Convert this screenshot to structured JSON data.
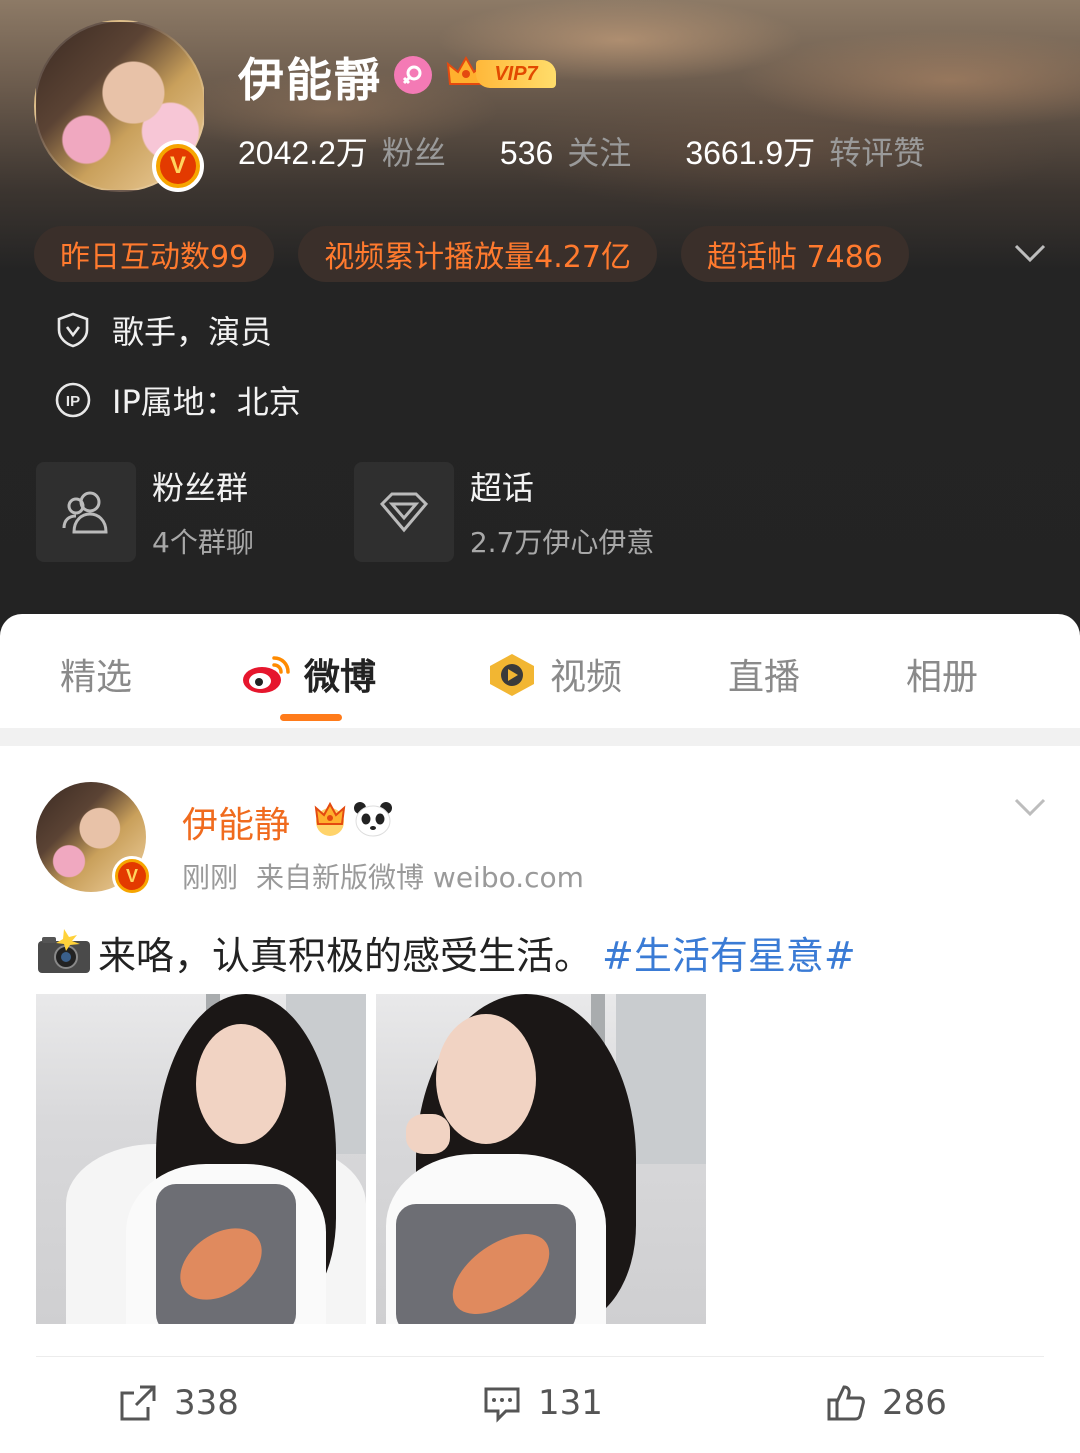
{
  "profile": {
    "name": "伊能靜",
    "vip_label": "VIP7",
    "verified_badge": "V",
    "stats": [
      {
        "value": "2042.2万",
        "label": "粉丝"
      },
      {
        "value": "536",
        "label": "关注"
      },
      {
        "value": "3661.9万",
        "label": "转评赞"
      }
    ],
    "chips": [
      {
        "label": "昨日互动数99"
      },
      {
        "label": "视频累计播放量4.27亿"
      },
      {
        "label": "超话帖 7486"
      }
    ],
    "info": [
      {
        "icon": "shield-v-icon",
        "text": "歌手，演员"
      },
      {
        "icon": "ip-icon",
        "text": "IP属地：北京"
      }
    ],
    "cards": [
      {
        "icon": "people-icon",
        "title": "粉丝群",
        "sub": "4个群聊"
      },
      {
        "icon": "diamond-icon",
        "title": "超话",
        "sub": "2.7万伊心伊意"
      }
    ]
  },
  "tabs": [
    {
      "label": "精选",
      "active": false
    },
    {
      "label": "微博",
      "active": true,
      "icon": "weibo-icon"
    },
    {
      "label": "视频",
      "active": false,
      "icon": "video-icon"
    },
    {
      "label": "直播",
      "active": false
    },
    {
      "label": "相册",
      "active": false
    }
  ],
  "post": {
    "author": "伊能静",
    "time": "刚刚",
    "source": "来自新版微博 weibo.com",
    "text": "来咯，认真积极的感受生活。",
    "hashtag": "#生活有星意#",
    "actions": {
      "repost": "338",
      "comment": "131",
      "like": "286"
    }
  },
  "colors": {
    "accent": "#ff7b1a",
    "chip_text": "#ff7a2e",
    "hashtag": "#3a7bd5",
    "author_name": "#f06b1e"
  }
}
